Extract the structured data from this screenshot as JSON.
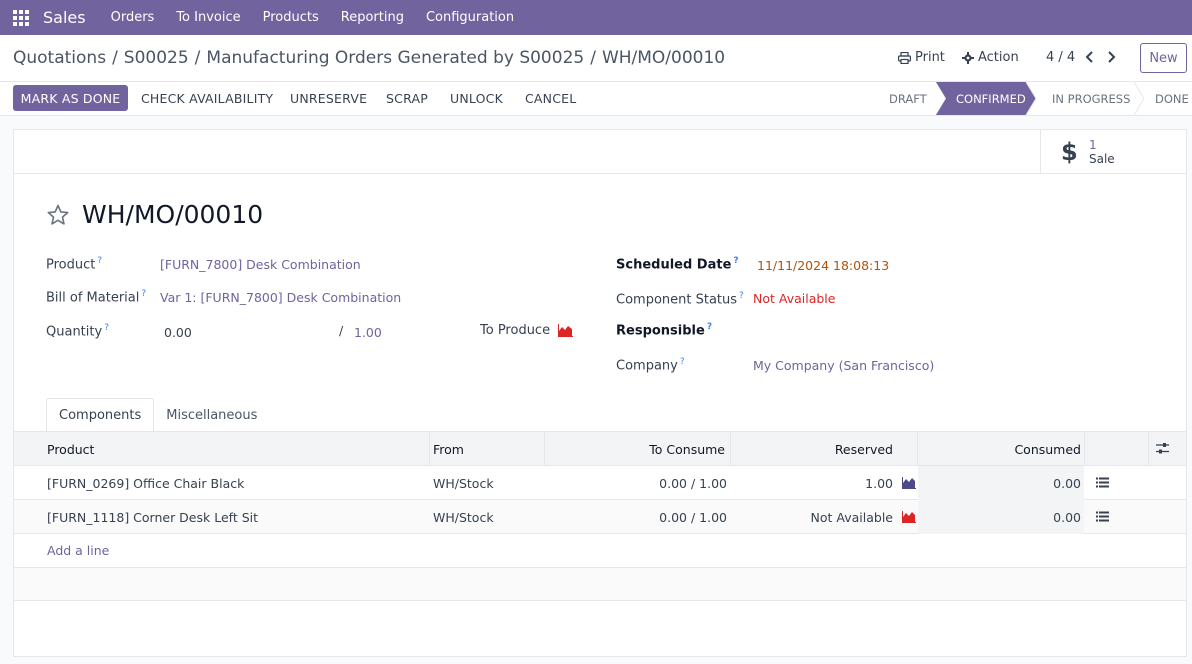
{
  "navbar": {
    "app_name": "Sales",
    "menu": [
      "Orders",
      "To Invoice",
      "Products",
      "Reporting",
      "Configuration"
    ],
    "color": "#71639e"
  },
  "breadcrumb": {
    "items": [
      "Quotations",
      "S00025",
      "Manufacturing Orders Generated by S00025"
    ],
    "current": "WH/MO/00010",
    "separator": "/"
  },
  "control_panel": {
    "print_label": "Print",
    "action_label": "Action",
    "pager": "4 / 4",
    "new_label": "New"
  },
  "statusbar": {
    "buttons": [
      "MARK AS DONE",
      "CHECK AVAILABILITY",
      "UNRESERVE",
      "SCRAP",
      "UNLOCK",
      "CANCEL"
    ],
    "stages": [
      "DRAFT",
      "CONFIRMED",
      "IN PROGRESS",
      "DONE"
    ],
    "active_stage": "CONFIRMED"
  },
  "smart_button": {
    "count": "1",
    "label": "Sale",
    "icon": "dollar-icon"
  },
  "record": {
    "title": "WH/MO/00010",
    "starred": false
  },
  "fields": {
    "product_label": "Product",
    "product_value": "[FURN_7800] Desk Combination",
    "bom_label": "Bill of Material",
    "bom_value": "Var 1: [FURN_7800] Desk Combination",
    "quantity_label": "Quantity",
    "quantity_produced": "0.00",
    "quantity_sep": "/",
    "quantity_total": "1.00",
    "to_produce_label": "To Produce",
    "scheduled_date_label": "Scheduled Date",
    "scheduled_date_value": "11/11/2024 18:08:13",
    "component_status_label": "Component Status",
    "component_status_value": "Not Available",
    "responsible_label": "Responsible",
    "company_label": "Company",
    "company_value": "My Company (San Francisco)",
    "help_mark": "?"
  },
  "tabs": [
    "Components",
    "Miscellaneous"
  ],
  "table": {
    "headers": {
      "product": "Product",
      "from": "From",
      "to_consume": "To Consume",
      "reserved": "Reserved",
      "consumed": "Consumed"
    },
    "rows": [
      {
        "product": "[FURN_0269] Office Chair Black",
        "from": "WH/Stock",
        "to_consume": "0.00 / 1.00",
        "reserved": "1.00",
        "reserved_status": "ok",
        "consumed": "0.00"
      },
      {
        "product": "[FURN_1118] Corner Desk Left Sit",
        "from": "WH/Stock",
        "to_consume": "0.00 / 1.00",
        "reserved": "Not Available",
        "reserved_status": "unavailable",
        "consumed": "0.00"
      }
    ],
    "add_line": "Add a line"
  },
  "colors": {
    "primary": "#71639e",
    "danger": "#dc2626",
    "warning": "#b45309",
    "success": "#16a34a"
  }
}
